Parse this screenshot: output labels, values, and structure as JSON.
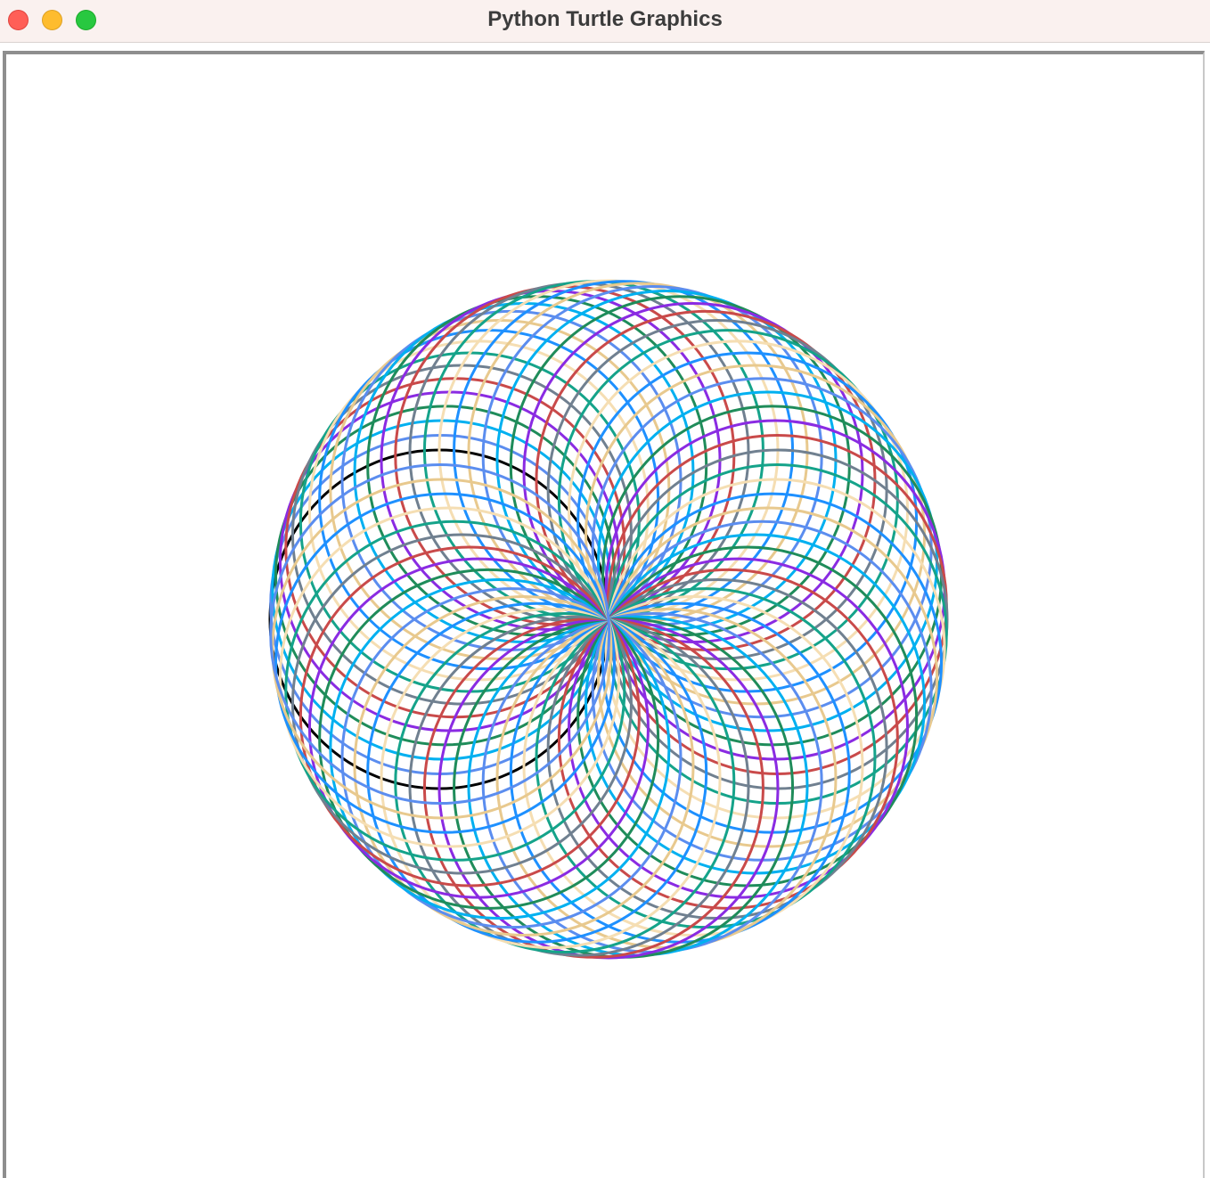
{
  "window": {
    "title": "Python Turtle Graphics",
    "buttons": {
      "close": "close-button",
      "minimize": "minimize-button",
      "zoom": "zoom-button"
    }
  },
  "canvas": {
    "background": "#ffffff",
    "pattern": "spirograph",
    "palette": [
      "#e8c98e",
      "#5b8def",
      "#00b0f0",
      "#1f8c5a",
      "#8a2be2",
      "#c94a4a",
      "#708090",
      "#15a38a",
      "#f5deb3",
      "#1e90ff"
    ],
    "first_stroke_color": "#000000"
  }
}
